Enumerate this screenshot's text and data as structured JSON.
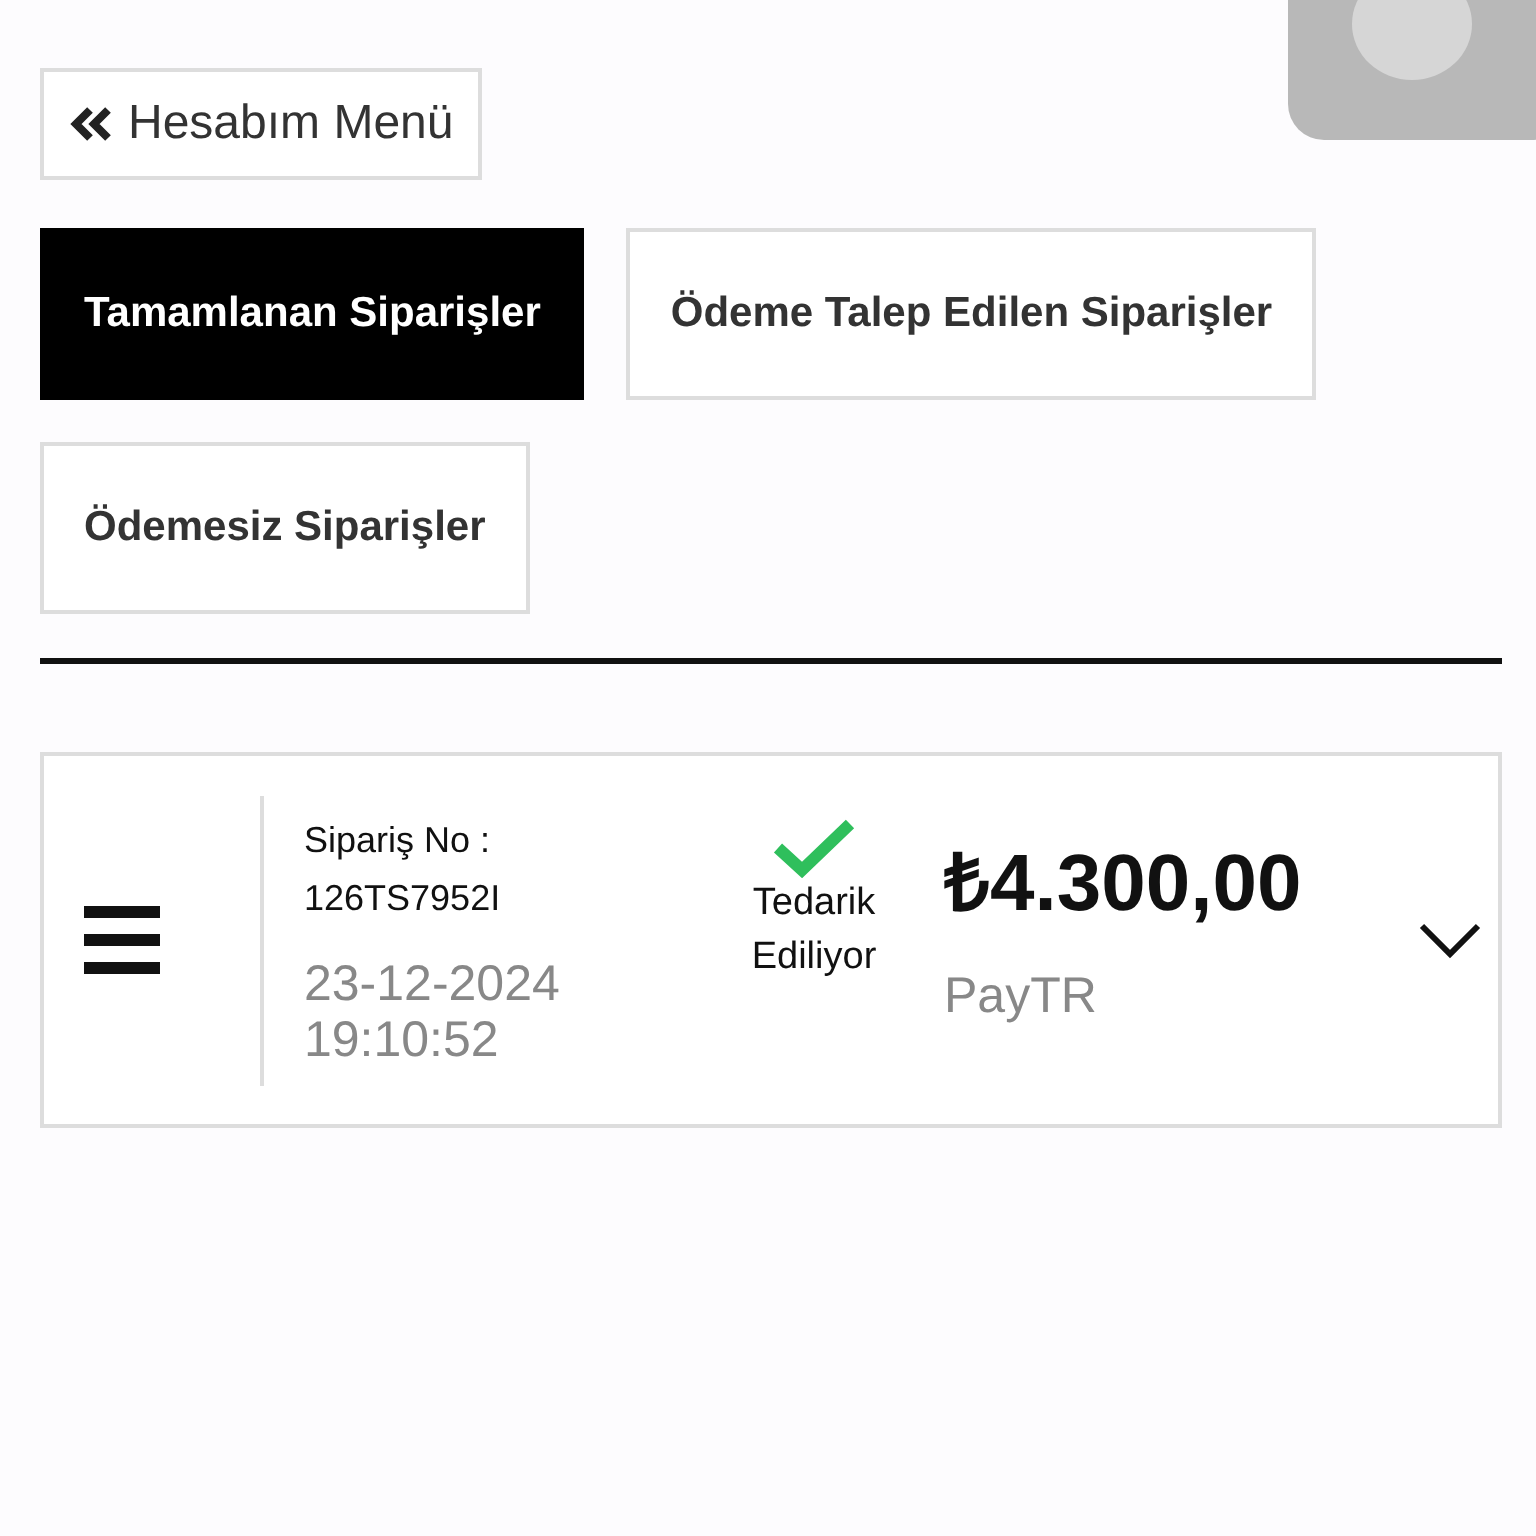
{
  "back_button": {
    "label": "Hesabım Menü"
  },
  "tabs": [
    {
      "label": "Tamamlanan Siparişler",
      "selected": true
    },
    {
      "label": "Ödeme Talep Edilen Siparişler",
      "selected": false
    },
    {
      "label": "Ödemesiz Siparişler",
      "selected": false
    }
  ],
  "orders": [
    {
      "order_no_label": "Sipariş No :",
      "order_no": "126TS7952I",
      "date": "23-12-2024",
      "time": "19:10:52",
      "status": "Tedarik Ediliyor",
      "status_ok": true,
      "amount": "₺4.300,00",
      "payment_method": "PayTR",
      "expanded": false
    }
  ]
}
